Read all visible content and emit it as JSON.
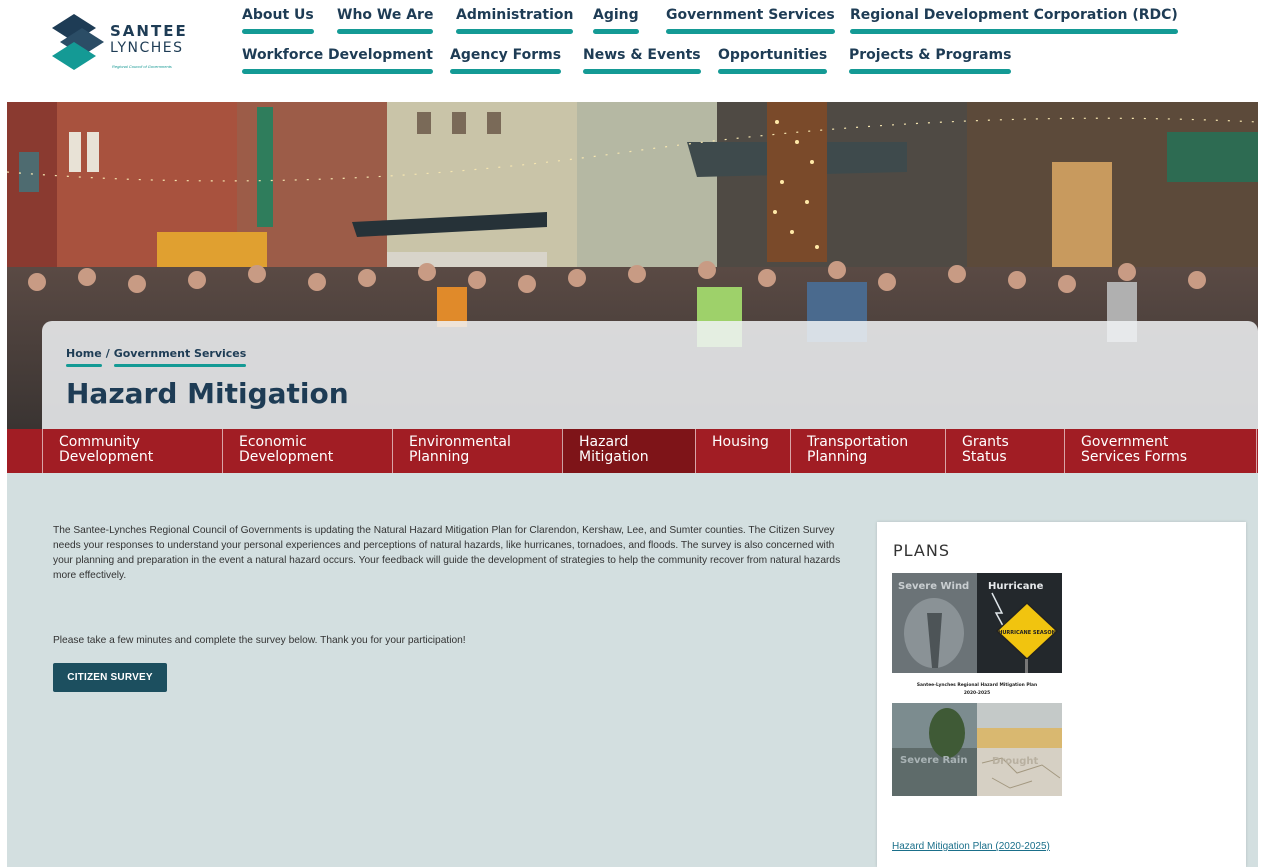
{
  "logo": {
    "line1": "SANTEE",
    "line2": "LYNCHES",
    "tagline": "Regional Council of Governments"
  },
  "nav": {
    "row1": [
      "About Us",
      "Who We Are",
      "Administration",
      "Aging",
      "Government Services",
      "Regional Development Corporation (RDC)"
    ],
    "row2": [
      "Workforce Development",
      "Agency Forms",
      "News & Events",
      "Opportunities",
      "Projects & Programs"
    ]
  },
  "breadcrumb": {
    "home": "Home",
    "separator": "/",
    "section": "Government Services"
  },
  "page_title": "Hazard Mitigation",
  "subnav": {
    "items": [
      "Community Development",
      "Economic Development",
      "Environmental Planning",
      "Hazard Mitigation",
      "Housing",
      "Transportation Planning",
      "Grants Status",
      "Government Services Forms"
    ],
    "active": "Hazard Mitigation"
  },
  "main": {
    "intro": "The Santee-Lynches Regional Council of Governments is updating the Natural Hazard Mitigation Plan for Clarendon, Kershaw, Lee, and Sumter counties. The Citizen Survey needs your responses to understand your personal experiences and perceptions of natural hazards, like hurricanes, tornadoes, and floods. The survey is also concerned with your planning and preparation in the event a natural hazard occurs. Your feedback will guide the development of strategies to help the community recover from natural hazards more effectively.",
    "please": "Please take a few minutes and complete the survey below. Thank you for your participation!",
    "survey_button": "CITIZEN SURVEY"
  },
  "plans": {
    "title": "PLANS",
    "cover": {
      "q1": "Severe Wind",
      "q2": "Hurricane",
      "sign": "HURRICANE SEASON",
      "band": "Santee-Lynches Regional Hazard Mitigation Plan",
      "band_years": "2020-2025",
      "q3": "Severe Rain",
      "q4": "Drought"
    },
    "link": "Hazard Mitigation Plan (2020-2025)"
  },
  "colors": {
    "navy": "#1e3c55",
    "teal": "#149a95",
    "crimson": "#a11d24",
    "background": "#d3dfe0"
  }
}
